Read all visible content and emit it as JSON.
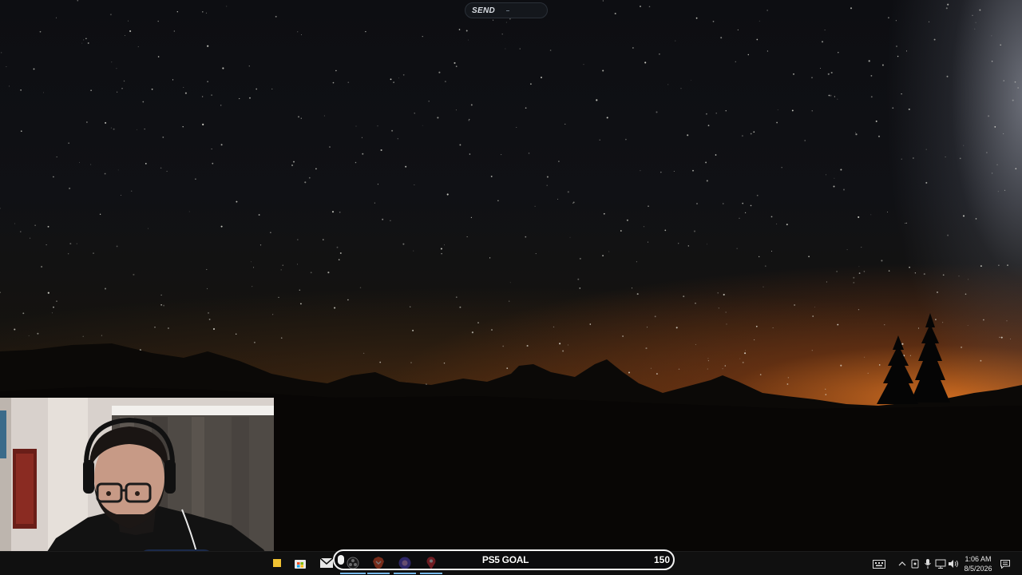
{
  "overlay": {
    "send_label": "SEND"
  },
  "goal": {
    "title": "PS5 GOAL",
    "target": "150"
  },
  "taskbar": {
    "icons": [
      "file-explorer-icon",
      "microsoft-store-icon",
      "mail-icon",
      "obs-icon",
      "brave-browser-icon",
      "app-icon",
      "maps-pin-icon"
    ]
  },
  "tray": {
    "icons": [
      "keyboard-icon",
      "chevron-up-icon",
      "device-icon",
      "microphone-icon",
      "network-icon",
      "volume-icon",
      "notification-icon"
    ],
    "time": "1:06 AM",
    "date": "8/5/2026"
  },
  "colors": {
    "taskbar": "#101010",
    "accent": "#76b9ed",
    "horizon_glow": "#d67022"
  }
}
